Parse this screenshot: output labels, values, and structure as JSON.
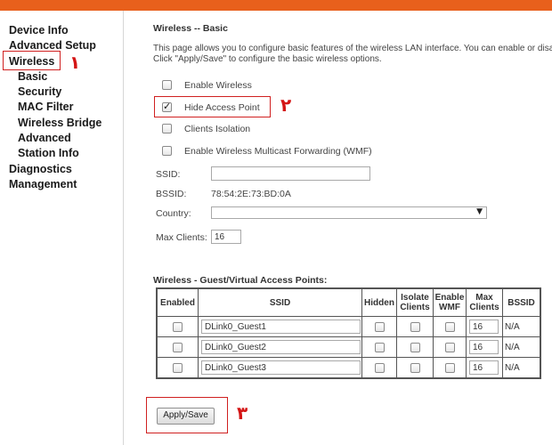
{
  "sidebar": {
    "items": [
      {
        "label": "Device Info"
      },
      {
        "label": "Advanced Setup"
      },
      {
        "label": "Wireless"
      },
      {
        "label": "Basic"
      },
      {
        "label": "Security"
      },
      {
        "label": "MAC Filter"
      },
      {
        "label": "Wireless Bridge"
      },
      {
        "label": "Advanced"
      },
      {
        "label": "Station Info"
      },
      {
        "label": "Diagnostics"
      },
      {
        "label": "Management"
      }
    ]
  },
  "annotations": {
    "m1": "١",
    "m2": "٢",
    "m3": "٣"
  },
  "page": {
    "title": "Wireless -- Basic",
    "desc_line1": "This page allows you to configure basic features of the wireless LAN interface. You can enable or disa",
    "desc_line2": "Click \"Apply/Save\" to configure the basic wireless options."
  },
  "options": {
    "enable_wireless": {
      "label": "Enable Wireless",
      "checked": false
    },
    "hide_ap": {
      "label": "Hide Access Point",
      "checked": true
    },
    "clients_isolation": {
      "label": "Clients Isolation",
      "checked": false
    },
    "wmf": {
      "label": "Enable Wireless Multicast Forwarding (WMF)",
      "checked": false
    }
  },
  "fields": {
    "ssid_label": "SSID:",
    "ssid_value": "",
    "bssid_label": "BSSID:",
    "bssid_value": "78:54:2E:73:BD:0A",
    "country_label": "Country:",
    "country_value": "",
    "max_clients_label": "Max Clients:",
    "max_clients_value": "16"
  },
  "guest": {
    "title": "Wireless - Guest/Virtual Access Points:",
    "headers": {
      "enabled": "Enabled",
      "ssid": "SSID",
      "hidden": "Hidden",
      "isolate1": "Isolate",
      "isolate2": "Clients",
      "wmf1": "Enable",
      "wmf2": "WMF",
      "max1": "Max",
      "max2": "Clients",
      "bssid": "BSSID"
    },
    "rows": [
      {
        "ssid": "DLink0_Guest1",
        "max": "16",
        "bssid": "N/A"
      },
      {
        "ssid": "DLink0_Guest2",
        "max": "16",
        "bssid": "N/A"
      },
      {
        "ssid": "DLink0_Guest3",
        "max": "16",
        "bssid": "N/A"
      }
    ]
  },
  "buttons": {
    "apply": "Apply/Save"
  },
  "colors": {
    "topbar": "#e8601c",
    "annotation": "#d41515"
  }
}
